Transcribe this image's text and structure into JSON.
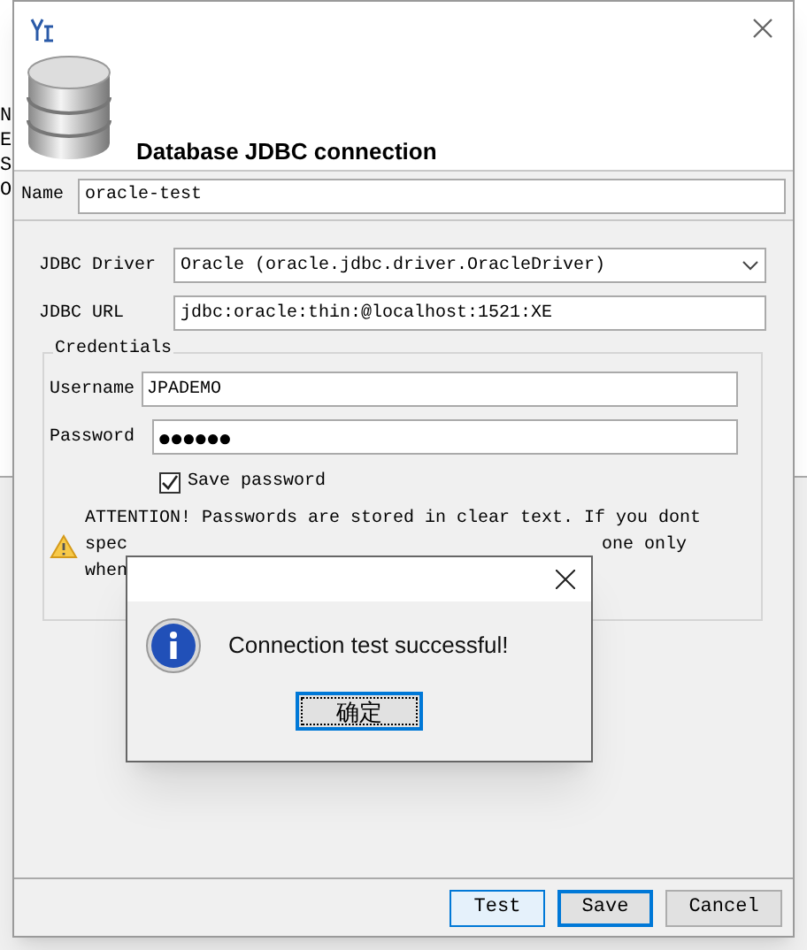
{
  "background_window": {
    "fragments": [
      "N",
      "E",
      "S",
      "O"
    ]
  },
  "dialog": {
    "header_title": "Database JDBC connection",
    "name": {
      "label": "Name",
      "value": "oracle-test"
    },
    "driver": {
      "label": "JDBC Driver",
      "value": "Oracle (oracle.jdbc.driver.OracleDriver)"
    },
    "url": {
      "label": "JDBC URL",
      "value": "jdbc:oracle:thin:@localhost:1521:XE"
    },
    "credentials": {
      "legend": "Credentials",
      "username": {
        "label": "Username",
        "value": "JPADEMO"
      },
      "password": {
        "label": "Password",
        "value": "●●●●●●"
      },
      "save_password": {
        "label": "Save password",
        "checked": true
      },
      "attention": {
        "line_1": "ATTENTION! Passwords are stored in clear text. If you dont",
        "line_2_left": "spec",
        "line_2_right": "one only",
        "line_3_left": "when"
      }
    },
    "buttons": [
      {
        "label": "Test",
        "hovered": true,
        "focused": false
      },
      {
        "label": "Save",
        "hovered": false,
        "focused": true
      },
      {
        "label": "Cancel",
        "hovered": false,
        "focused": false
      }
    ]
  },
  "message_box": {
    "message": "Connection test successful!",
    "button": "确定"
  }
}
